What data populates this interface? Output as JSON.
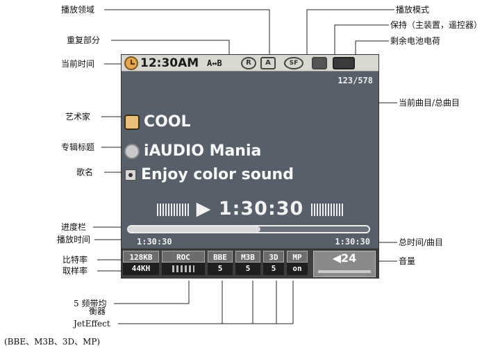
{
  "callouts": {
    "play_area": "播放领域",
    "repeat_section": "重复部分",
    "current_time": "当前时间",
    "artist": "艺术家",
    "album_title": "专辑标题",
    "song_name": "歌名",
    "progress_bar": "进度栏",
    "play_time": "播放时间",
    "bitrate": "比特率",
    "sample_rate": "取样率",
    "equalizer_a": "5 频带均",
    "equalizer_b": "衡器",
    "jeteffect": "JetEffect",
    "jeteffect_list": "(BBE、M3B、3D、MP)",
    "play_mode": "播放模式",
    "hold": "保持（主装置，遥控器）",
    "battery": "剩余电池电荷",
    "track_count": "当前曲目/总曲目",
    "total_time": "总时间/曲目",
    "volume": "音量"
  },
  "screen": {
    "time": "12:30AM",
    "repeat": "A↔B",
    "track_count": "123/578",
    "artist": "COOL",
    "album": "iAUDIO Mania",
    "song": "Enjoy color sound",
    "play_symbol": "▶",
    "play_time": "1:30:30",
    "elapsed": "1:30:30",
    "total": "1:30:30",
    "progress": 0.55,
    "bitrate": "128KB",
    "sample_rate": "44KH",
    "eq_label": "ROC",
    "bbe_label": "BBE",
    "bbe_value": "5",
    "m3b_label": "M3B",
    "m3b_value": "5",
    "d3_label": "3D",
    "d3_value": "5",
    "mp_label": "MP",
    "mp_value": "on",
    "volume": "24",
    "volume_icon": "speaker-icon"
  },
  "colors": {
    "screen_bg": "#575f6a",
    "status_bg": "#d8d8d0",
    "bottom_bg": "#3f3f3f"
  }
}
